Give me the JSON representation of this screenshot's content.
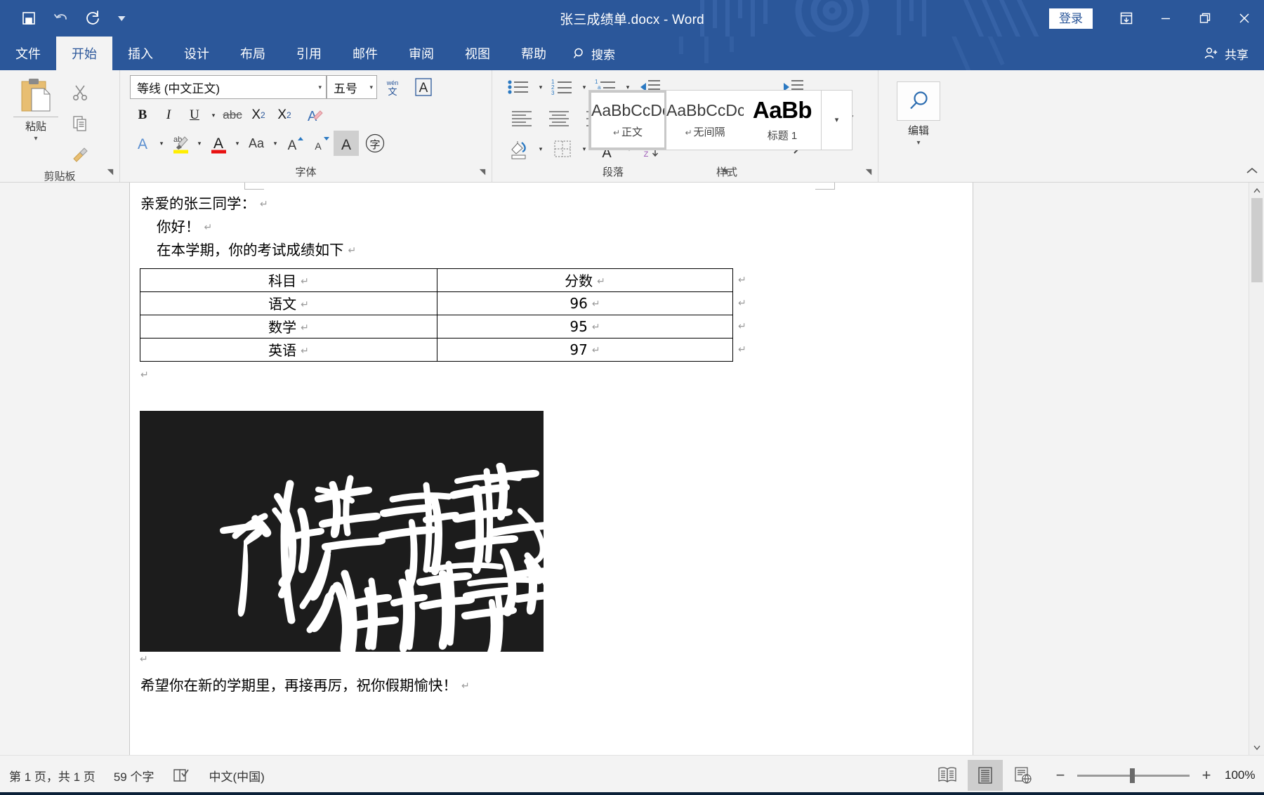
{
  "window": {
    "title": "张三成绩单.docx  -  Word",
    "signin_label": "登录",
    "ribbon_display_icon": "ribbon-display-options-icon",
    "minimize_icon": "minimize-icon",
    "restore_icon": "restore-icon",
    "close_icon": "close-icon"
  },
  "quick_access": {
    "save_icon": "save-icon",
    "undo_icon": "undo-icon",
    "redo_icon": "redo-icon",
    "customize_icon": "chevron-down-icon"
  },
  "tabs": [
    {
      "label": "文件",
      "active": false
    },
    {
      "label": "开始",
      "active": true
    },
    {
      "label": "插入",
      "active": false
    },
    {
      "label": "设计",
      "active": false
    },
    {
      "label": "布局",
      "active": false
    },
    {
      "label": "引用",
      "active": false
    },
    {
      "label": "邮件",
      "active": false
    },
    {
      "label": "审阅",
      "active": false
    },
    {
      "label": "视图",
      "active": false
    },
    {
      "label": "帮助",
      "active": false
    }
  ],
  "search": {
    "label": "搜索",
    "icon": "search-icon"
  },
  "share": {
    "label": "共享",
    "icon": "share-person-icon"
  },
  "ribbon": {
    "groups": [
      {
        "name": "clipboard",
        "label": "剪贴板"
      },
      {
        "name": "font",
        "label": "字体"
      },
      {
        "name": "paragraph",
        "label": "段落"
      },
      {
        "name": "styles",
        "label": "样式"
      },
      {
        "name": "editing",
        "label": ""
      }
    ],
    "clipboard": {
      "paste_label": "粘贴",
      "paste_icon": "paste-icon",
      "cut_icon": "scissors-icon",
      "copy_icon": "copy-icon",
      "format_painter_icon": "format-painter-icon"
    },
    "font": {
      "font_name": "等线 (中文正文)",
      "font_size": "五号",
      "phonetic_guide_icon": "phonetic-guide-icon",
      "character_border_icon": "character-border-icon",
      "bold": "B",
      "italic": "I",
      "underline": "U",
      "strikethrough": "abc",
      "subscript": "X₂",
      "superscript": "X²",
      "clear_format_icon": "clear-formatting-icon",
      "text_effects_icon": "text-effects-icon",
      "highlight_icon": "highlight-color-icon",
      "font_color_icon": "font-color-icon",
      "change_case": "Aa",
      "grow_font_icon": "grow-font-icon",
      "shrink_font_icon": "shrink-font-icon",
      "char_shading_icon": "character-shading-icon",
      "enclose_char_icon": "enclose-character-icon"
    },
    "paragraph": {
      "bullets_icon": "bullet-list-icon",
      "numbering_icon": "numbered-list-icon",
      "multilevel_icon": "multilevel-list-icon",
      "decrease_indent_icon": "decrease-indent-icon",
      "increase_indent_icon": "increase-indent-icon",
      "align_left_icon": "align-left-icon",
      "align_center_icon": "align-center-icon",
      "align_right_icon": "align-right-icon",
      "justify_icon": "justify-icon",
      "distribute_icon": "distribute-text-icon",
      "line_spacing_icon": "line-spacing-icon",
      "shading_icon": "shading-icon",
      "borders_icon": "borders-icon",
      "asian_layout_icon": "asian-layout-icon",
      "sort_icon": "sort-az-icon",
      "show_marks_icon": "show-formatting-marks-icon"
    },
    "styles": {
      "items": [
        {
          "sample": "AaBbCcDc",
          "name": "正文",
          "pilcrow": "↵",
          "selected": true,
          "heading": false
        },
        {
          "sample": "AaBbCcDc",
          "name": "无间隔",
          "pilcrow": "↵",
          "selected": false,
          "heading": false
        },
        {
          "sample": "AaBb",
          "name": "标题 1",
          "pilcrow": "",
          "selected": false,
          "heading": true
        }
      ],
      "more_icon": "chevron-down-icon"
    },
    "editing": {
      "label": "编辑",
      "icon": "search-magnifier-icon",
      "caret_icon": "chevron-down-icon"
    },
    "collapse_icon": "collapse-ribbon-icon"
  },
  "document": {
    "paragraphs": [
      {
        "text": "亲爱的张三同学：",
        "indent": false
      },
      {
        "text": "你好！",
        "indent": true
      },
      {
        "text": "在本学期，你的考试成绩如下",
        "indent": true
      }
    ],
    "table": {
      "headers": [
        "科目",
        "分数"
      ],
      "rows": [
        [
          "语文",
          "96"
        ],
        [
          "数学",
          "95"
        ],
        [
          "英语",
          "97"
        ]
      ]
    },
    "image": {
      "alt": "calligraphy-image",
      "caption_text": "执着于理想，纯粹于当下",
      "background_color": "#1c1c1c",
      "ink_color": "#ffffff"
    },
    "closing": "希望你在新的学期里，再接再厉，祝你假期愉快！",
    "pilcrow": "↵"
  },
  "statusbar": {
    "page_info": "第 1 页，共 1 页",
    "word_count": "59 个字",
    "proofing_icon": "proofing-errors-icon",
    "language": "中文(中国)",
    "views": [
      {
        "name": "read-mode",
        "icon": "read-mode-icon",
        "active": false
      },
      {
        "name": "print-layout",
        "icon": "print-layout-icon",
        "active": true
      },
      {
        "name": "web-layout",
        "icon": "web-layout-icon",
        "active": false
      }
    ],
    "zoom_out": "−",
    "zoom_in": "+",
    "zoom_level": "100%"
  }
}
